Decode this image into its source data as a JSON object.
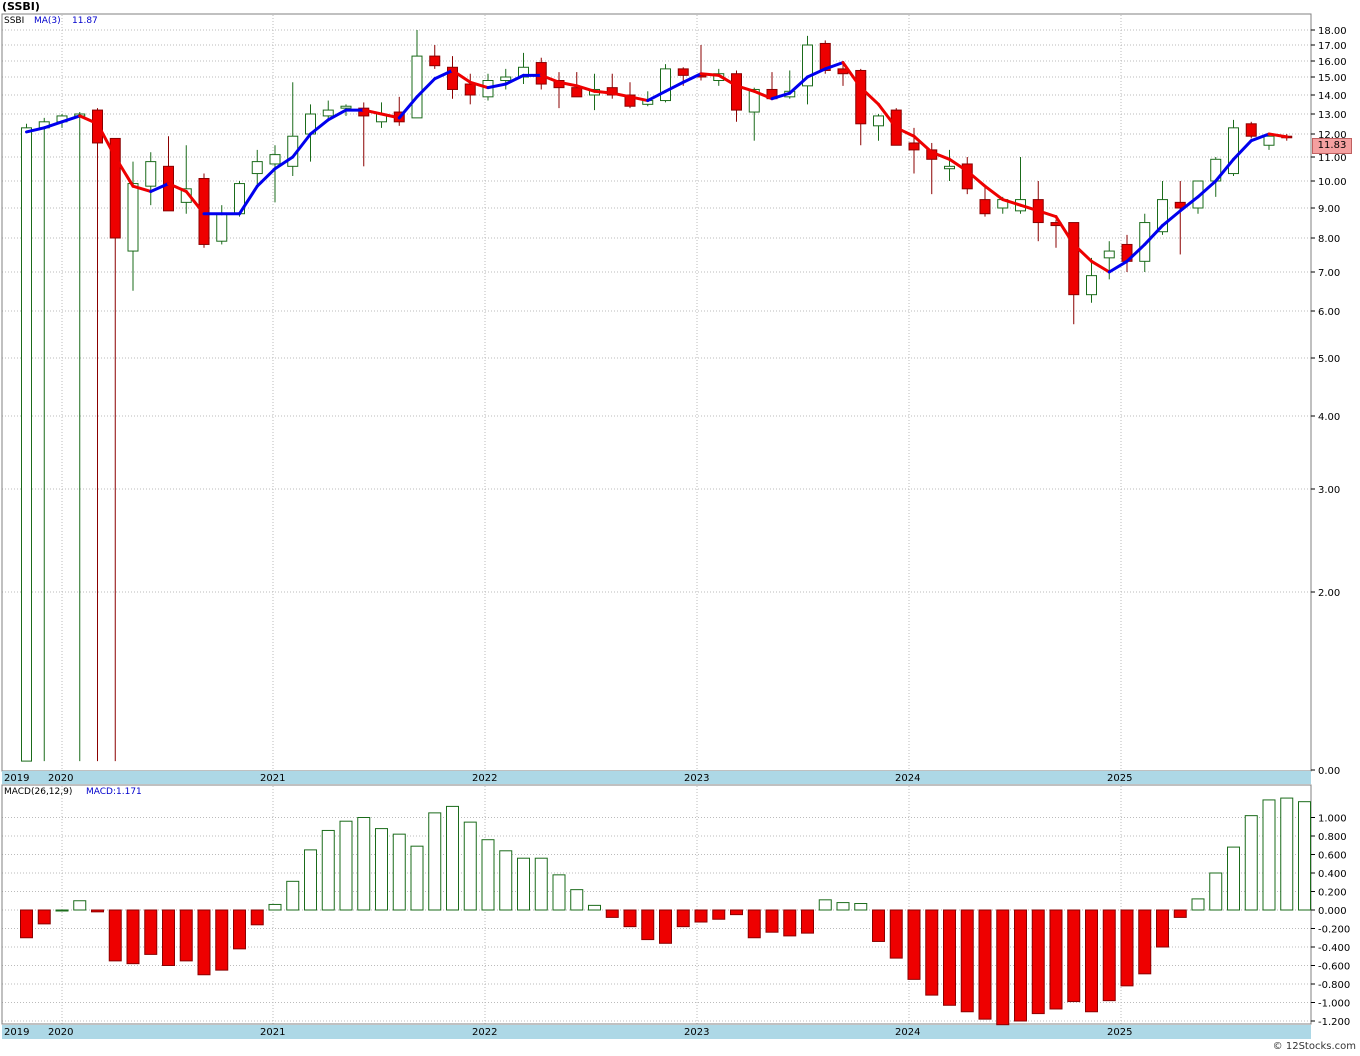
{
  "header": {
    "title": "(SSBI)"
  },
  "legend": {
    "symbol": "SSBI",
    "ma_label": "MA(3)",
    "ma_value": "11.87",
    "macd_label": "MACD(26,12,9)",
    "macd_value_label": "MACD:1.171"
  },
  "last_price": "11.83",
  "footer": {
    "copyright": "© 12Stocks.com"
  },
  "colors": {
    "up_candle": "#1a6b1a",
    "down_candle": "#ee0000",
    "ma_up": "#0000ee",
    "ma_down": "#ee0000",
    "axis_band": "#add8e6",
    "grid": "#bbbbbb"
  },
  "chart_data": [
    {
      "type": "candlestick",
      "scale": "log",
      "x_tick_labels": [
        "2019",
        "2020",
        "2021",
        "2022",
        "2023",
        "2024",
        "2025"
      ],
      "y_tick_labels": [
        "18.00",
        "17.00",
        "16.00",
        "15.00",
        "14.00",
        "13.00",
        "12.00",
        "11.00",
        "10.00",
        "9.00",
        "8.00",
        "7.00",
        "6.00",
        "5.00",
        "4.00",
        "3.00",
        "2.00",
        "0.00"
      ],
      "y_ticks": [
        18,
        17,
        16,
        15,
        14,
        13,
        12,
        11,
        10,
        9,
        8,
        7,
        6,
        5,
        4,
        3,
        2
      ],
      "months": [
        "2019-11",
        "2019-12",
        "2020-01",
        "2020-02",
        "2020-03",
        "2020-04",
        "2020-05",
        "2020-06",
        "2020-07",
        "2020-08",
        "2020-09",
        "2020-10",
        "2020-11",
        "2020-12",
        "2021-01",
        "2021-02",
        "2021-03",
        "2021-04",
        "2021-05",
        "2021-06",
        "2021-07",
        "2021-08",
        "2021-09",
        "2021-10",
        "2021-11",
        "2021-12",
        "2022-01",
        "2022-02",
        "2022-03",
        "2022-04",
        "2022-05",
        "2022-06",
        "2022-07",
        "2022-08",
        "2022-09",
        "2022-10",
        "2022-11",
        "2022-12",
        "2023-01",
        "2023-02",
        "2023-03",
        "2023-04",
        "2023-05",
        "2023-06",
        "2023-07",
        "2023-08",
        "2023-09",
        "2023-10",
        "2023-11",
        "2023-12",
        "2024-01",
        "2024-02",
        "2024-03",
        "2024-04",
        "2024-05",
        "2024-06",
        "2024-07",
        "2024-08",
        "2024-09",
        "2024-10",
        "2024-11",
        "2024-12",
        "2025-01",
        "2025-02",
        "2025-03",
        "2025-04",
        "2025-05",
        "2025-06",
        "2025-07",
        "2025-08",
        "2025-09",
        "2025-10",
        "2025-11"
      ],
      "ohlc": [
        [
          0.1,
          12.5,
          0.1,
          12.3
        ],
        [
          12.3,
          12.8,
          0.1,
          12.6
        ],
        [
          12.6,
          13.0,
          12.3,
          12.9
        ],
        [
          12.9,
          13.1,
          0.1,
          13.0
        ],
        [
          13.2,
          13.3,
          0.1,
          11.6
        ],
        [
          11.8,
          11.8,
          0.1,
          8.0
        ],
        [
          7.6,
          10.8,
          6.5,
          9.9
        ],
        [
          9.8,
          11.2,
          9.1,
          10.8
        ],
        [
          10.6,
          11.9,
          8.9,
          8.9
        ],
        [
          9.2,
          11.5,
          8.8,
          9.7
        ],
        [
          10.1,
          10.3,
          7.7,
          7.8
        ],
        [
          7.9,
          9.1,
          7.8,
          8.8
        ],
        [
          8.8,
          10.0,
          8.7,
          9.9
        ],
        [
          10.3,
          11.3,
          9.8,
          10.8
        ],
        [
          10.7,
          11.5,
          9.2,
          11.1
        ],
        [
          10.6,
          14.7,
          10.2,
          11.9
        ],
        [
          12.0,
          13.5,
          10.8,
          13.0
        ],
        [
          12.9,
          13.7,
          12.7,
          13.2
        ],
        [
          13.3,
          13.5,
          12.9,
          13.4
        ],
        [
          13.3,
          13.6,
          10.6,
          12.9
        ],
        [
          12.6,
          13.6,
          12.3,
          13.0
        ],
        [
          13.1,
          13.9,
          12.4,
          12.6
        ],
        [
          12.8,
          18.0,
          12.8,
          16.3
        ],
        [
          16.3,
          17.0,
          15.5,
          15.7
        ],
        [
          15.6,
          16.3,
          13.8,
          14.3
        ],
        [
          14.6,
          15.2,
          13.5,
          14.0
        ],
        [
          13.9,
          15.2,
          13.7,
          14.8
        ],
        [
          14.8,
          15.5,
          14.3,
          15.0
        ],
        [
          15.0,
          16.5,
          14.6,
          15.6
        ],
        [
          15.9,
          16.2,
          14.3,
          14.6
        ],
        [
          14.8,
          15.3,
          13.3,
          14.4
        ],
        [
          14.4,
          15.3,
          14.1,
          13.9
        ],
        [
          14.0,
          15.2,
          13.2,
          14.3
        ],
        [
          14.4,
          15.2,
          13.8,
          14.0
        ],
        [
          14.0,
          14.7,
          13.3,
          13.4
        ],
        [
          13.5,
          14.2,
          13.4,
          13.7
        ],
        [
          13.7,
          15.8,
          13.6,
          15.5
        ],
        [
          15.5,
          15.6,
          14.5,
          15.1
        ],
        [
          15.1,
          17.0,
          14.8,
          15.0
        ],
        [
          14.8,
          15.5,
          14.5,
          15.2
        ],
        [
          15.2,
          15.4,
          12.6,
          13.2
        ],
        [
          13.1,
          14.4,
          11.7,
          14.3
        ],
        [
          14.3,
          15.3,
          13.8,
          13.8
        ],
        [
          13.9,
          15.4,
          13.8,
          14.2
        ],
        [
          14.5,
          17.6,
          13.5,
          17.0
        ],
        [
          17.1,
          17.3,
          15.2,
          15.4
        ],
        [
          15.5,
          16.0,
          14.5,
          15.2
        ],
        [
          15.4,
          15.5,
          11.5,
          12.5
        ],
        [
          12.4,
          13.0,
          11.7,
          12.9
        ],
        [
          13.2,
          13.3,
          11.5,
          11.5
        ],
        [
          11.6,
          12.3,
          10.3,
          11.3
        ],
        [
          11.3,
          11.6,
          9.5,
          10.9
        ],
        [
          10.5,
          11.3,
          10.0,
          10.6
        ],
        [
          10.7,
          11.0,
          9.5,
          9.7
        ],
        [
          9.3,
          9.8,
          8.7,
          8.8
        ],
        [
          9.0,
          9.4,
          8.8,
          9.3
        ],
        [
          8.9,
          11.0,
          8.8,
          9.3
        ],
        [
          9.3,
          10.0,
          7.9,
          8.5
        ],
        [
          8.5,
          8.6,
          7.7,
          8.4
        ],
        [
          8.5,
          8.5,
          5.7,
          6.4
        ],
        [
          6.4,
          7.4,
          6.2,
          6.9
        ],
        [
          7.4,
          7.9,
          6.8,
          7.6
        ],
        [
          7.8,
          8.1,
          7.0,
          7.3
        ],
        [
          7.3,
          8.8,
          7.0,
          8.5
        ],
        [
          8.2,
          10.0,
          8.1,
          9.3
        ],
        [
          9.2,
          10.0,
          7.5,
          9.0
        ],
        [
          9.0,
          10.0,
          8.8,
          10.0
        ],
        [
          10.0,
          11.0,
          9.4,
          10.9
        ],
        [
          10.3,
          12.7,
          10.2,
          12.3
        ],
        [
          12.5,
          12.6,
          11.8,
          11.9
        ],
        [
          11.5,
          12.0,
          11.3,
          11.9
        ],
        [
          11.9,
          12.0,
          11.7,
          11.83
        ]
      ],
      "ma3": [
        12.1,
        12.3,
        12.6,
        12.9,
        12.5,
        11.0,
        9.8,
        9.6,
        9.9,
        9.6,
        8.8,
        8.8,
        8.8,
        9.8,
        10.5,
        11.0,
        12.0,
        12.7,
        13.2,
        13.2,
        13.0,
        12.8,
        13.9,
        14.9,
        15.4,
        14.7,
        14.4,
        14.6,
        15.1,
        15.1,
        14.7,
        14.5,
        14.2,
        14.1,
        13.9,
        13.7,
        14.2,
        14.7,
        15.2,
        15.1,
        14.5,
        14.2,
        13.8,
        14.1,
        15.0,
        15.5,
        15.9,
        14.4,
        13.5,
        12.3,
        11.9,
        11.2,
        10.9,
        10.4,
        9.8,
        9.3,
        9.1,
        8.9,
        8.7,
        7.8,
        7.3,
        7.0,
        7.3,
        7.8,
        8.4,
        8.9,
        9.4,
        10.0,
        10.9,
        11.7,
        12.0,
        11.87
      ]
    },
    {
      "type": "bar",
      "name": "MACD(26,12,9)",
      "y_tick_labels": [
        "1.000",
        "0.800",
        "0.600",
        "0.400",
        "0.200",
        "0.000",
        "-0.200",
        "-0.400",
        "-0.600",
        "-0.800",
        "-1.000",
        "-1.200"
      ],
      "y_ticks": [
        1.0,
        0.8,
        0.6,
        0.4,
        0.2,
        0.0,
        -0.2,
        -0.4,
        -0.6,
        -0.8,
        -1.0,
        -1.2
      ],
      "values": [
        -0.3,
        -0.15,
        0.0,
        0.1,
        -0.02,
        -0.55,
        -0.58,
        -0.48,
        -0.6,
        -0.55,
        -0.7,
        -0.65,
        -0.42,
        -0.16,
        0.06,
        0.31,
        0.65,
        0.86,
        0.96,
        1.0,
        0.88,
        0.82,
        0.69,
        1.05,
        1.12,
        0.95,
        0.76,
        0.64,
        0.56,
        0.56,
        0.38,
        0.22,
        0.05,
        -0.08,
        -0.18,
        -0.32,
        -0.36,
        -0.18,
        -0.13,
        -0.1,
        -0.05,
        -0.3,
        -0.24,
        -0.28,
        -0.25,
        0.11,
        0.08,
        0.07,
        -0.34,
        -0.52,
        -0.75,
        -0.92,
        -1.03,
        -1.1,
        -1.18,
        -1.24,
        -1.2,
        -1.12,
        -1.07,
        -0.99,
        -1.1,
        -0.98,
        -0.82,
        -0.69,
        -0.4,
        -0.08,
        0.12,
        0.4,
        0.68,
        1.02,
        1.19,
        1.21,
        1.171
      ]
    }
  ]
}
